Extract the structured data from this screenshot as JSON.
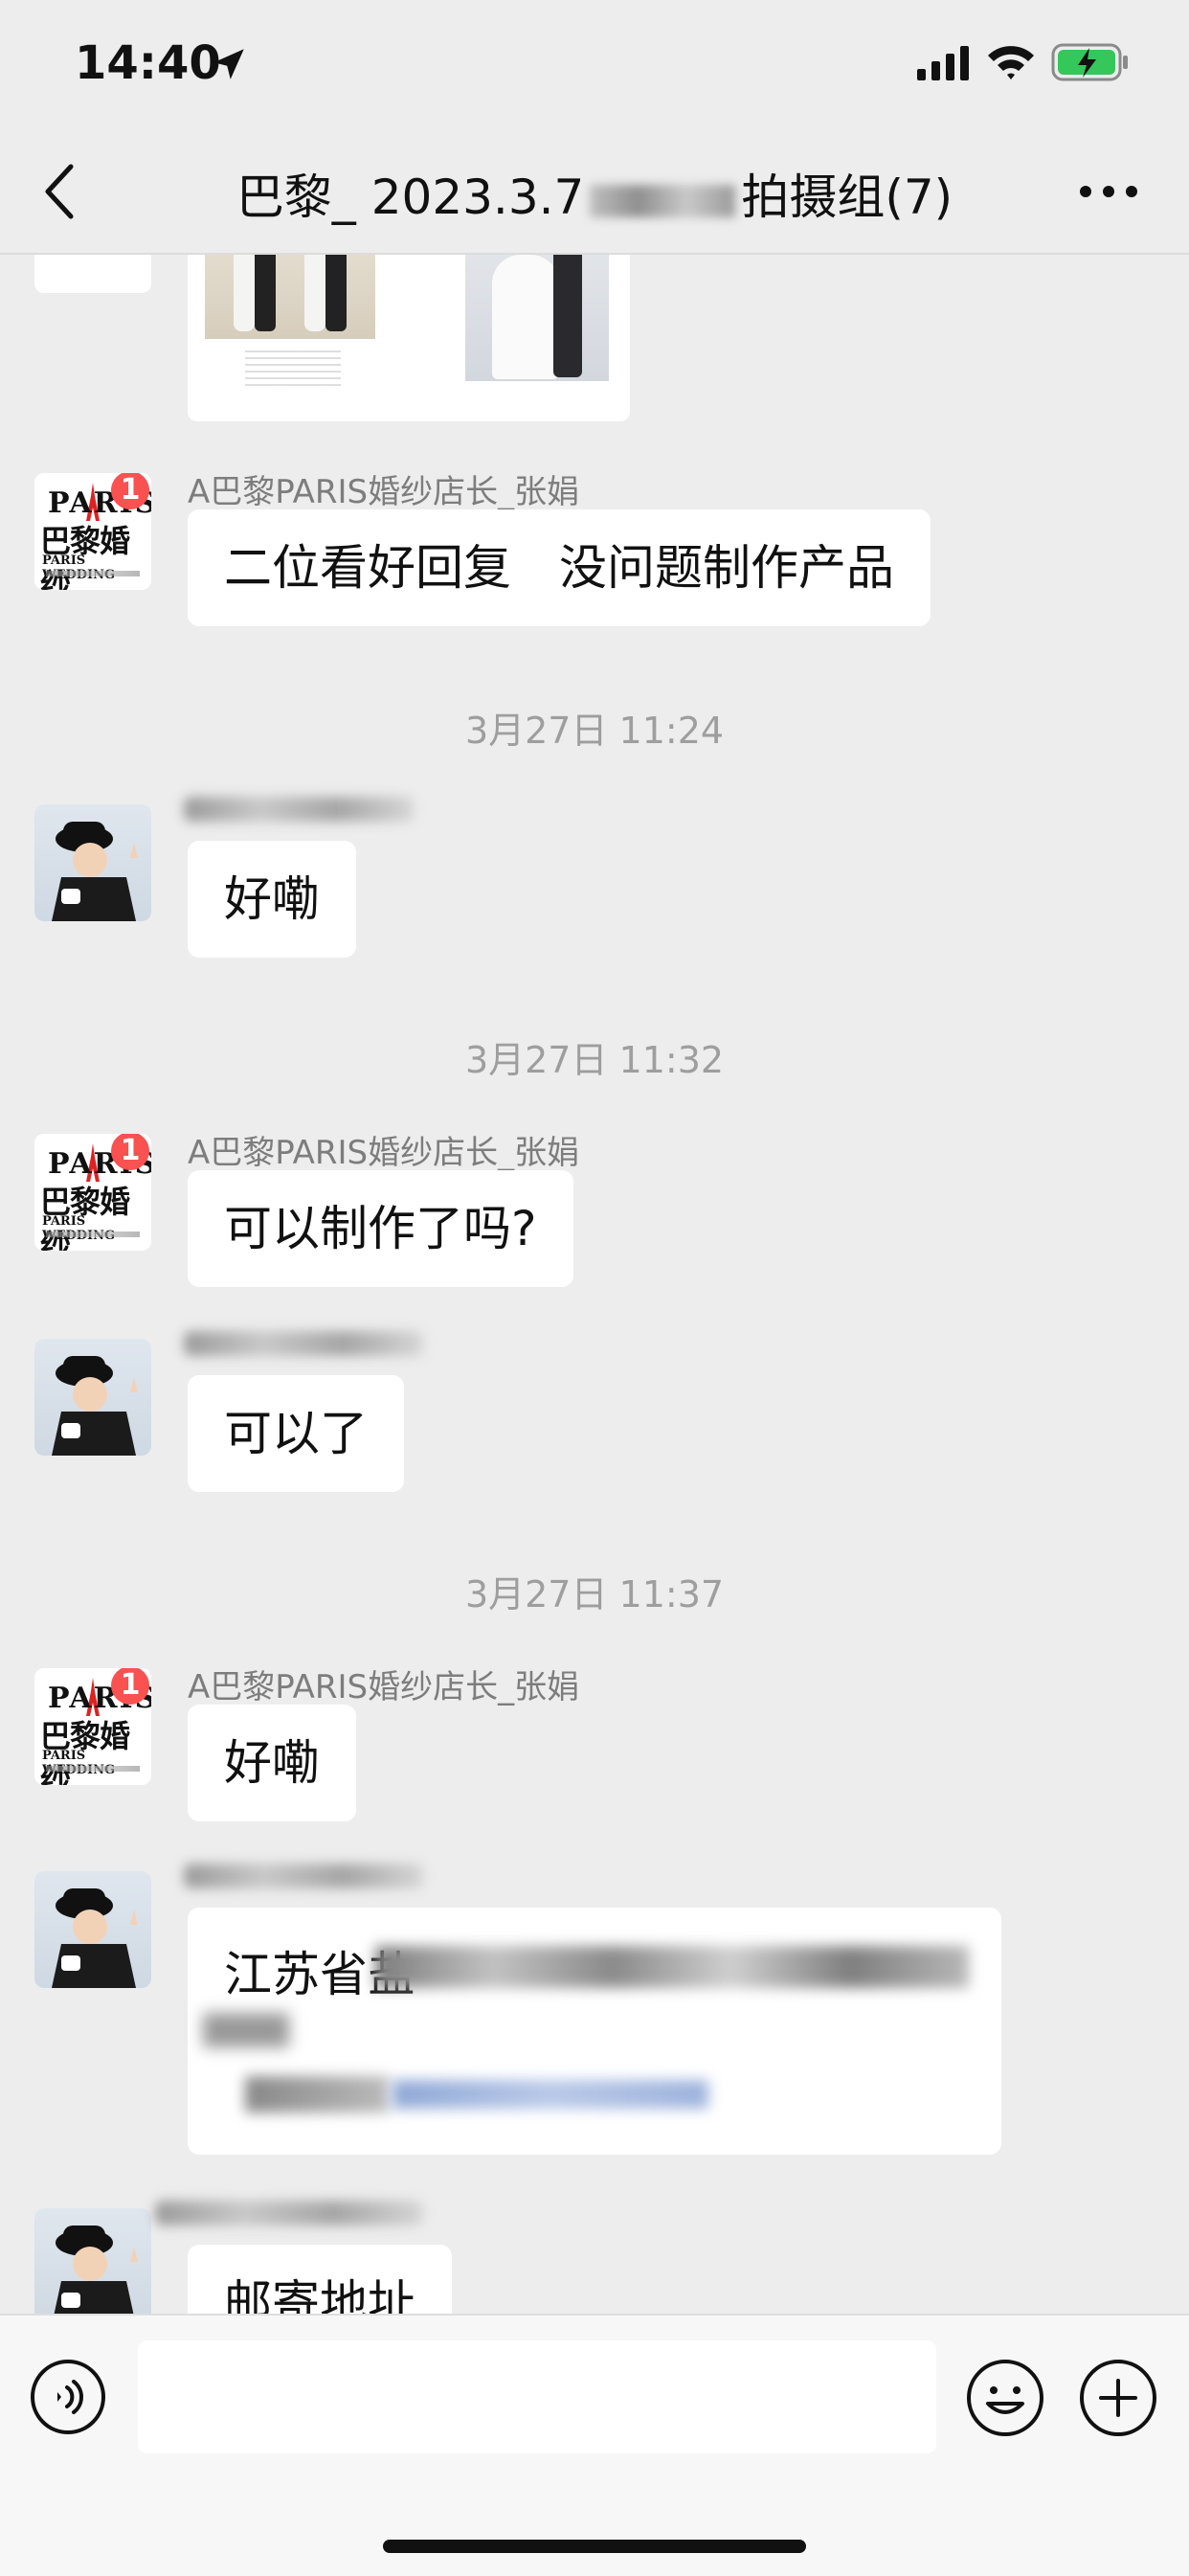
{
  "status_bar": {
    "time": "14:40"
  },
  "nav": {
    "title_prefix": "巴黎_ 2023.3.7",
    "title_suffix": "拍摄组(7)"
  },
  "logo": {
    "line1": "PARIS",
    "line2": "巴黎婚纱",
    "line3": "PARIS WEDDING",
    "badge": "1"
  },
  "messages": {
    "m1": {
      "sender": "A巴黎PARIS婚纱店长_张娟",
      "text": "二位看好回复　没问题制作产品"
    },
    "ts1": "3月27日 11:24",
    "m2": {
      "text": "好嘞"
    },
    "ts2": "3月27日 11:32",
    "m3": {
      "sender": "A巴黎PARIS婚纱店长_张娟",
      "text": "可以制作了吗?"
    },
    "m4": {
      "text": "可以了"
    },
    "ts3": "3月27日 11:37",
    "m5": {
      "sender": "A巴黎PARIS婚纱店长_张娟",
      "text": "好嘞"
    },
    "m6": {
      "text": "江苏省盐"
    },
    "m7": {
      "text": "邮寄地址"
    }
  },
  "colors": {
    "background": "#ededed",
    "bubble": "#ffffff",
    "badge": "#fa5151"
  }
}
